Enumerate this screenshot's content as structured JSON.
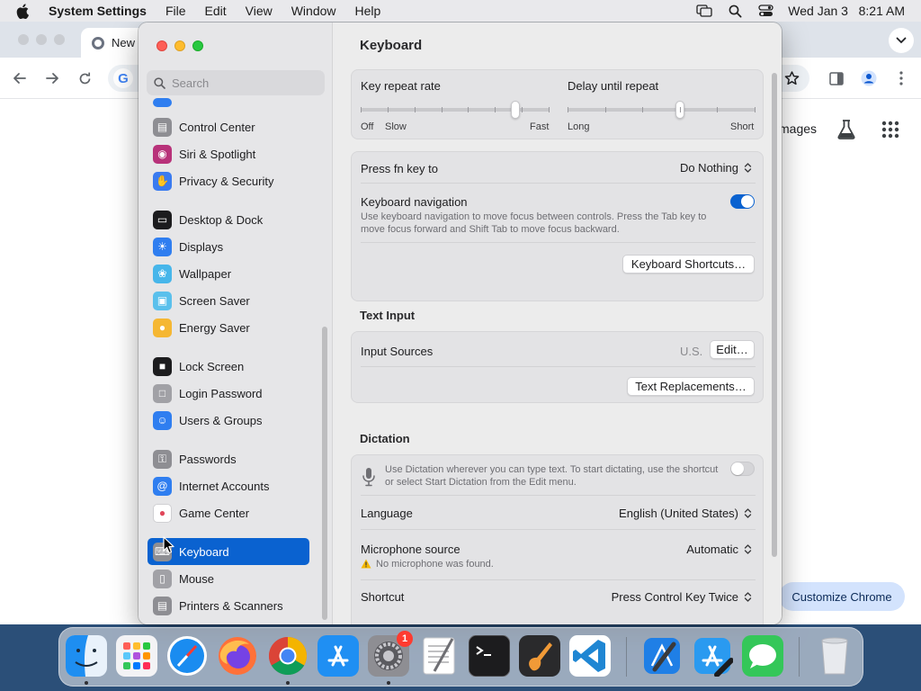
{
  "menubar": {
    "app_name": "System Settings",
    "items": [
      "File",
      "Edit",
      "View",
      "Window",
      "Help"
    ],
    "clock": "Wed Jan 3   8:21 AM"
  },
  "chrome": {
    "tab_title": "New",
    "images_link": "mages",
    "customize_button": "Customize Chrome"
  },
  "settings": {
    "search_placeholder": "Search",
    "sidebar": {
      "items": [
        {
          "label": "Control Center",
          "icon": "control-center-icon",
          "color": "#8e8e93"
        },
        {
          "label": "Siri & Spotlight",
          "icon": "siri-icon",
          "color": "#b8327a"
        },
        {
          "label": "Privacy & Security",
          "icon": "hand-icon",
          "color": "#3a7bf0"
        },
        {
          "label": "Desktop & Dock",
          "icon": "dock-icon",
          "color": "#1c1c1e"
        },
        {
          "label": "Displays",
          "icon": "sun-icon",
          "color": "#2f7ef0"
        },
        {
          "label": "Wallpaper",
          "icon": "flower-icon",
          "color": "#47b6ea"
        },
        {
          "label": "Screen Saver",
          "icon": "screen-saver-icon",
          "color": "#5ac0ec"
        },
        {
          "label": "Energy Saver",
          "icon": "bulb-icon",
          "color": "#f5b733"
        },
        {
          "label": "Lock Screen",
          "icon": "lock-icon",
          "color": "#1c1c1e"
        },
        {
          "label": "Login Password",
          "icon": "lock-outline-icon",
          "color": "#a1a1a6"
        },
        {
          "label": "Users & Groups",
          "icon": "users-icon",
          "color": "#2f7ef0"
        },
        {
          "label": "Passwords",
          "icon": "key-icon",
          "color": "#8e8e93"
        },
        {
          "label": "Internet Accounts",
          "icon": "at-icon",
          "color": "#2f7ef0"
        },
        {
          "label": "Game Center",
          "icon": "game-center-icon",
          "color": "#ffffff"
        },
        {
          "label": "Keyboard",
          "icon": "keyboard-icon",
          "color": "#8e8e93"
        },
        {
          "label": "Mouse",
          "icon": "mouse-icon",
          "color": "#a1a1a6"
        },
        {
          "label": "Printers & Scanners",
          "icon": "printer-icon",
          "color": "#8e8e93"
        }
      ],
      "selected": "Keyboard"
    },
    "content": {
      "title": "Keyboard",
      "key_repeat": {
        "label": "Key repeat rate",
        "min": "Off",
        "slow": "Slow",
        "max": "Fast",
        "level": 0.82
      },
      "delay_repeat": {
        "label": "Delay until repeat",
        "min": "Long",
        "max": "Short",
        "level": 0.6
      },
      "fn_key": {
        "label": "Press fn key to",
        "value": "Do Nothing"
      },
      "keyboard_navigation": {
        "label": "Keyboard navigation",
        "description": "Use keyboard navigation to move focus between controls. Press the Tab key to move focus forward and Shift Tab to move focus backward.",
        "enabled": true
      },
      "shortcuts_button": "Keyboard Shortcuts…",
      "text_input": {
        "section_title": "Text Input",
        "input_sources_label": "Input Sources",
        "input_sources_value": "U.S.",
        "edit_button": "Edit…",
        "replacements_button": "Text Replacements…"
      },
      "dictation": {
        "section_title": "Dictation",
        "description": "Use Dictation wherever you can type text. To start dictating, use the shortcut or select Start Dictation from the Edit menu.",
        "enabled": false,
        "language_label": "Language",
        "language_value": "English (United States)",
        "mic_label": "Microphone source",
        "mic_value": "Automatic",
        "mic_warning": "No microphone was found.",
        "shortcut_label": "Shortcut",
        "shortcut_value": "Press Control Key Twice"
      }
    }
  },
  "dock": {
    "apps": [
      {
        "name": "Finder",
        "icon": "finder-icon",
        "running": true
      },
      {
        "name": "Launchpad",
        "icon": "launchpad-icon",
        "running": false
      },
      {
        "name": "Safari",
        "icon": "safari-icon",
        "running": false
      },
      {
        "name": "Firefox",
        "icon": "firefox-icon",
        "running": false
      },
      {
        "name": "Google Chrome",
        "icon": "chrome-icon",
        "running": true
      },
      {
        "name": "App Store",
        "icon": "app-store-icon",
        "running": false
      },
      {
        "name": "System Settings",
        "icon": "system-settings-icon",
        "running": true,
        "badge": "1"
      },
      {
        "name": "TextEdit",
        "icon": "textedit-icon",
        "running": false
      },
      {
        "name": "Terminal",
        "icon": "terminal-icon",
        "running": false
      },
      {
        "name": "GarageBand",
        "icon": "garageband-icon",
        "running": false
      },
      {
        "name": "Visual Studio Code",
        "icon": "vscode-icon",
        "running": false
      },
      {
        "name": "Xcode",
        "icon": "xcode-icon",
        "running": false
      },
      {
        "name": "Simulator",
        "icon": "simulator-icon",
        "running": false
      },
      {
        "name": "Messages",
        "icon": "messages-icon",
        "running": false
      },
      {
        "name": "Trash",
        "icon": "trash-icon",
        "running": false
      }
    ]
  }
}
